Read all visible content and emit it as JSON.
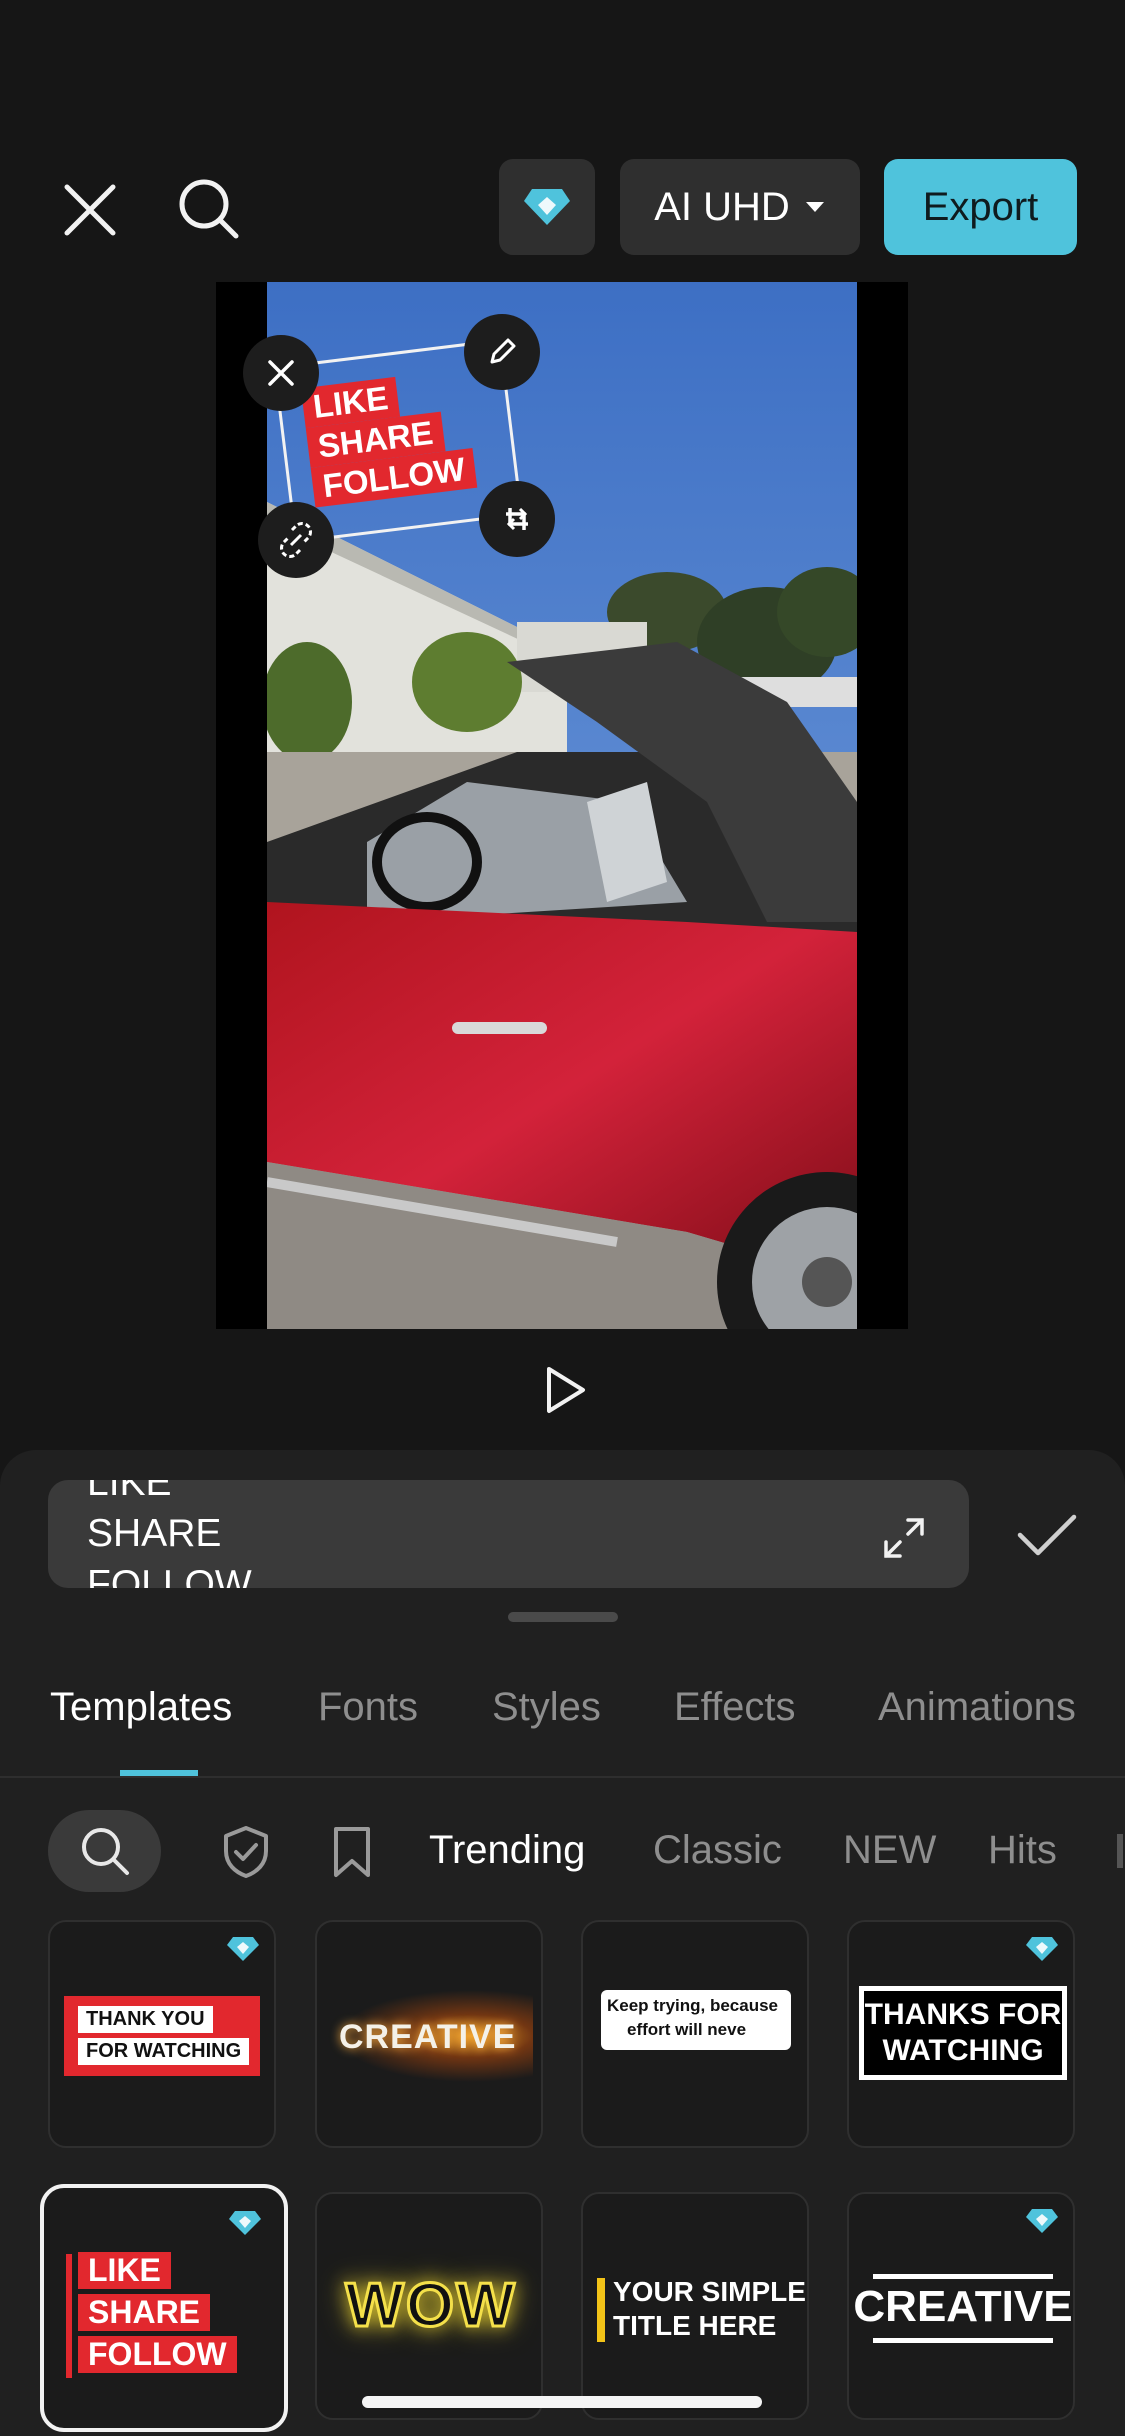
{
  "toolbar": {
    "close_icon": "close-icon",
    "search_icon": "search-icon",
    "pro_icon": "diamond-icon",
    "resolution_label": "AI UHD",
    "export_label": "Export"
  },
  "sticker": {
    "lines": [
      "LIKE",
      "SHARE",
      "FOLLOW"
    ]
  },
  "text_input": {
    "line_top": "LIKE",
    "line_mid": "SHARE",
    "line_bottom": "FOLLOW"
  },
  "tabs": [
    {
      "label": "Templates",
      "active": true
    },
    {
      "label": "Fonts"
    },
    {
      "label": "Styles"
    },
    {
      "label": "Effects"
    },
    {
      "label": "Animations"
    }
  ],
  "filters": [
    {
      "label": "Trending",
      "active": true
    },
    {
      "label": "Classic"
    },
    {
      "label": "NEW"
    },
    {
      "label": "Hits"
    }
  ],
  "templates": [
    {
      "name": "thank-you-for-watching",
      "lines": [
        "THANK YOU",
        "FOR WATCHING"
      ],
      "pro": true
    },
    {
      "name": "creative-sparkle",
      "text": "CREATIVE",
      "pro": false
    },
    {
      "name": "keep-trying",
      "lines": [
        "Keep trying, because",
        "effort will neve"
      ],
      "pro": false
    },
    {
      "name": "thanks-for-watching-box",
      "lines": [
        "THANKS FOR",
        "WATCHING"
      ],
      "pro": true
    },
    {
      "name": "like-share-follow",
      "lines": [
        "LIKE",
        "SHARE",
        "FOLLOW"
      ],
      "pro": true,
      "selected": true
    },
    {
      "name": "wow",
      "text": "WOW",
      "pro": false
    },
    {
      "name": "your-simple-title",
      "lines": [
        "YOUR SIMPLE",
        "TITLE HERE"
      ],
      "pro": false
    },
    {
      "name": "creative-bold",
      "text": "CREATIVE",
      "pro": true
    }
  ],
  "colors": {
    "accent": "#4fc3dc",
    "background": "#161616",
    "sheet": "#202020",
    "sticker_red": "#e2282e"
  }
}
